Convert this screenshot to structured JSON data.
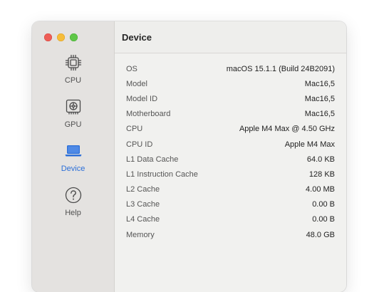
{
  "sidebar": {
    "items": [
      {
        "label": "CPU",
        "icon": "cpu-icon",
        "active": false
      },
      {
        "label": "GPU",
        "icon": "gpu-icon",
        "active": false
      },
      {
        "label": "Device",
        "icon": "laptop-icon",
        "active": true
      },
      {
        "label": "Help",
        "icon": "help-icon",
        "active": false
      }
    ]
  },
  "header": {
    "title": "Device"
  },
  "info": {
    "rows": [
      {
        "label": "OS",
        "value": "macOS 15.1.1 (Build 24B2091)"
      },
      {
        "label": "Model",
        "value": "Mac16,5"
      },
      {
        "label": "Model ID",
        "value": "Mac16,5"
      },
      {
        "label": "Motherboard",
        "value": "Mac16,5"
      },
      {
        "label": "CPU",
        "value": "Apple M4 Max @ 4.50 GHz"
      },
      {
        "label": "CPU ID",
        "value": "Apple M4 Max"
      },
      {
        "label": "L1 Data Cache",
        "value": "64.0 KB"
      },
      {
        "label": "L1 Instruction Cache",
        "value": "128 KB"
      },
      {
        "label": "L2 Cache",
        "value": "4.00 MB"
      },
      {
        "label": "L3 Cache",
        "value": "0.00 B"
      },
      {
        "label": "L4 Cache",
        "value": "0.00 B"
      },
      {
        "label": "Memory",
        "value": "48.0 GB"
      }
    ]
  },
  "colors": {
    "accent": "#2c6fd8",
    "traffic_red": "#ee5e57",
    "traffic_yellow": "#f6bd3a",
    "traffic_green": "#5fc748"
  }
}
